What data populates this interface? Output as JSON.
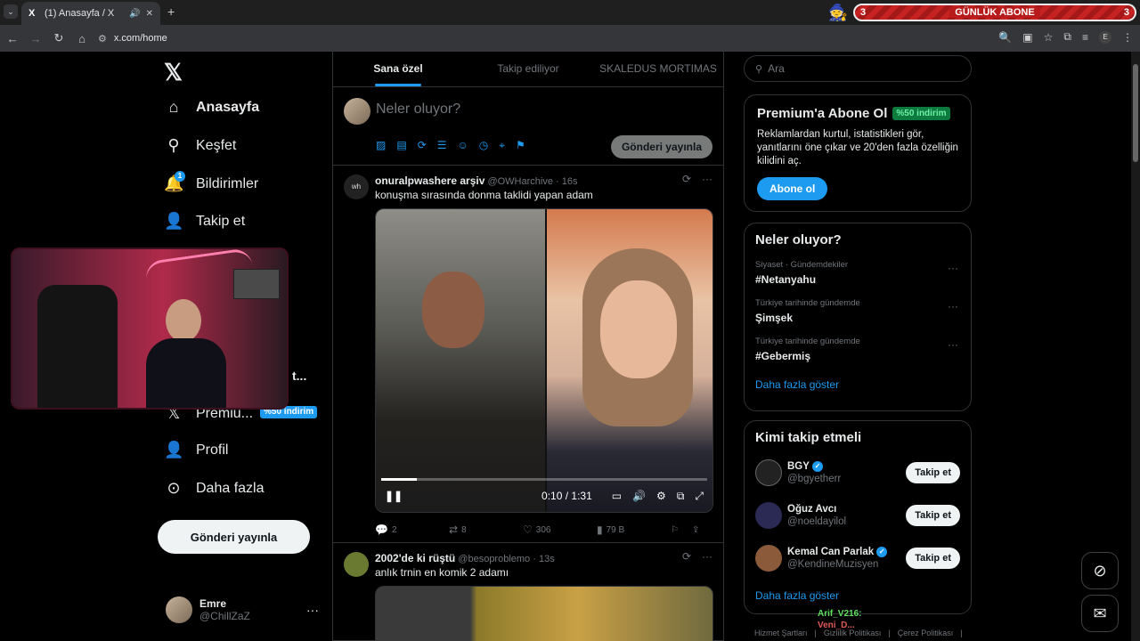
{
  "browser": {
    "tab_title": "(1) Anasayfa / X",
    "url": "x.com/home",
    "profile_initial": "E"
  },
  "stream_overlay": {
    "sub_count_left": "3",
    "sub_label": "GÜNLÜK ABONE",
    "sub_count_right": "3"
  },
  "sidebar": {
    "logo": "𝕏",
    "items": [
      {
        "label": "Anasayfa",
        "icon": "home-icon"
      },
      {
        "label": "Keşfet",
        "icon": "search-icon"
      },
      {
        "label": "Bildirimler",
        "icon": "bell-icon",
        "badge": "1"
      },
      {
        "label": "Takip et",
        "icon": "follow-icon"
      },
      {
        "label": "t...",
        "icon": ""
      },
      {
        "label": "Premiu...",
        "icon": "x-icon",
        "badge": "%50 indirim"
      },
      {
        "label": "Profil",
        "icon": "person-icon"
      },
      {
        "label": "Daha fazla",
        "icon": "more-circle-icon"
      }
    ],
    "post_button": "Gönderi yayınla",
    "account": {
      "name": "Emre",
      "handle": "@ChillZaZ"
    }
  },
  "timeline": {
    "tabs": [
      "Sana özel",
      "Takip ediliyor",
      "SKALEDUS MORTIMAS"
    ],
    "composer": {
      "placeholder": "Neler oluyor?",
      "post_button": "Gönderi yayınla"
    },
    "tweets": [
      {
        "name": "onuralpwashere arşiv",
        "handle": "@OWHarchive",
        "time": "16s",
        "avatar_text": "wh",
        "text": "konuşma sırasında donma taklidi yapan adam",
        "video": {
          "time": "0:10 / 1:31",
          "progress": 0.11
        },
        "replies": "2",
        "reposts": "8",
        "likes": "306",
        "views": "79 B"
      },
      {
        "name": "2002'de ki rüştü",
        "handle": "@besoproblemo",
        "time": "13s",
        "text": "anlık trnin en komik 2 adamı"
      }
    ]
  },
  "right": {
    "search_placeholder": "Ara",
    "premium": {
      "title": "Premium'a Abone Ol",
      "discount": "%50 indirim",
      "desc": "Reklamlardan kurtul, istatistikleri gör, yanıtlarını öne çıkar ve 20'den fazla özelliğin kilidini aç.",
      "button": "Abone ol"
    },
    "trends": {
      "title": "Neler oluyor?",
      "items": [
        {
          "context": "Siyaset · Gündemdekiler",
          "name": "#Netanyahu"
        },
        {
          "context": "Türkiye tarihinde gündemde",
          "name": "Şimşek"
        },
        {
          "context": "Türkiye tarihinde gündemde",
          "name": "#Gebermiş"
        }
      ],
      "more": "Daha fazla göster"
    },
    "who_to_follow": {
      "title": "Kimi takip etmeli",
      "items": [
        {
          "name": "BGY",
          "handle": "@bgyetherr",
          "verified": true,
          "button": "Takip et"
        },
        {
          "name": "Oğuz Avcı",
          "handle": "@noeldayilol",
          "verified": false,
          "button": "Takip et"
        },
        {
          "name": "Kemal Can Parlak",
          "handle": "@KendineMuzisyen",
          "verified": true,
          "button": "Takip et"
        }
      ],
      "more": "Daha fazla göster"
    },
    "footer": [
      "Hizmet Şartları",
      "|",
      "Gizlilik Politikası",
      "|",
      "Çerez Politikası",
      "|"
    ]
  },
  "chat": {
    "line1": "Arif_V216:",
    "line2": "Veni_D..."
  }
}
